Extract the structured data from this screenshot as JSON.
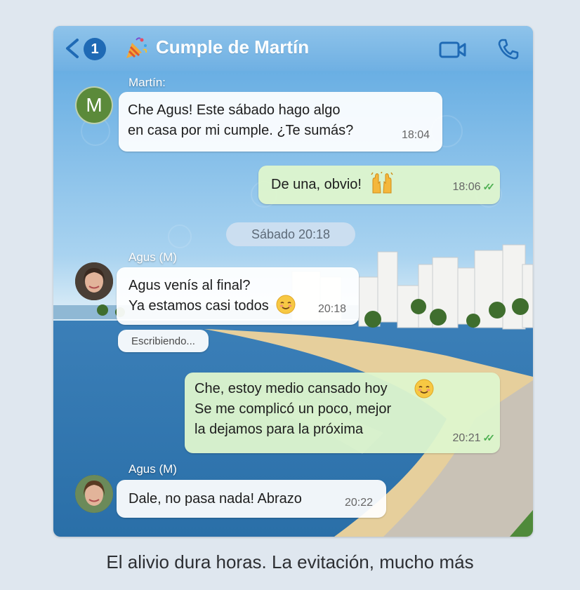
{
  "header": {
    "title": "Cumple de Martín",
    "unread_count": "1",
    "back_icon": "chevron-left-icon",
    "group_icon": "party-popper-icon",
    "video_icon": "video-camera-icon",
    "call_icon": "phone-icon",
    "accent_color": "#6fb0e3"
  },
  "messages": [
    {
      "sender": "Martín:",
      "avatar_letter": "M",
      "text": "Che Agus! Este sábado hago algo\nen casa por mi cumple. ¿Te sumás?",
      "time": "18:04",
      "direction": "incoming"
    },
    {
      "text": "De una, obvio!",
      "emoji": "raising-hands-emoji",
      "time": "18:06",
      "read": true,
      "direction": "outgoing"
    },
    {
      "sender": "Agus (M)",
      "text": "Agus venís al final?\nYa estamos casi todos",
      "emoji": "relieved-face-emoji",
      "time": "20:18",
      "direction": "incoming"
    },
    {
      "text": "Che, estoy medio cansado hoy\nSe me complicó un poco, mejor\nla dejamos para la próxima",
      "emoji": "relieved-face-emoji",
      "time": "20:21",
      "read": true,
      "direction": "outgoing"
    },
    {
      "sender": "Agus (M)",
      "text": "Dale, no pasa nada! Abrazo",
      "time": "20:22",
      "direction": "incoming"
    }
  ],
  "date_separator": "Sábado 20:18",
  "typing_indicator": "Escribiendo...",
  "caption": "El alivio dura horas. La evitación, mucho más"
}
